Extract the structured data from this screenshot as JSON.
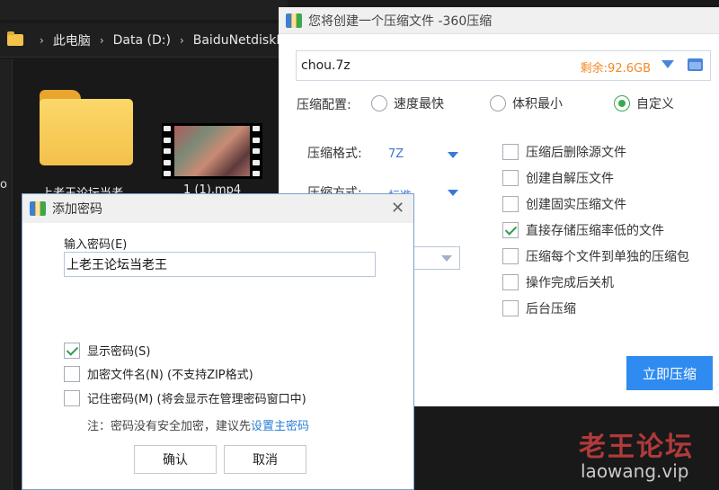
{
  "explorer": {
    "breadcrumb": [
      "此电脑",
      "Data (D:)",
      "BaiduNetdiskD"
    ],
    "folder_label": "上老王论坛当老",
    "video_label": "1 (1).mp4",
    "side_text": "o"
  },
  "compress_window": {
    "title": "您将创建一个压缩文件 -360压缩",
    "filename": "chou.7z",
    "free_space": "剩余:92.6GB",
    "config_label": "压缩配置:",
    "radios": [
      "速度最快",
      "体积最小",
      "自定义"
    ],
    "radio_selected": "自定义",
    "format_label": "压缩格式:",
    "format_value": "7Z",
    "method_label": "压缩方式:",
    "method_value": "标准",
    "options": [
      {
        "label": "压缩后删除源文件",
        "checked": false
      },
      {
        "label": "创建自解压文件",
        "checked": false
      },
      {
        "label": "创建固实压缩文件",
        "checked": false
      },
      {
        "label": "直接存储压缩率低的文件",
        "checked": true
      },
      {
        "label": "压缩每个文件到单独的压缩包",
        "checked": false
      },
      {
        "label": "操作完成后关机",
        "checked": false
      },
      {
        "label": "后台压缩",
        "checked": false
      }
    ],
    "start_button": "立即压缩"
  },
  "password_dialog": {
    "title": "添加密码",
    "input_label": "输入密码(E)",
    "password_value": "上老王论坛当老王",
    "checks": [
      {
        "label": "显示密码(S)",
        "checked": true
      },
      {
        "label": "加密文件名(N) (不支持ZIP格式)",
        "checked": false
      },
      {
        "label": "记住密码(M) (将会显示在管理密码窗口中)",
        "checked": false
      }
    ],
    "note_text": "注：密码没有安全加密，建议先",
    "note_link": "设置主密码",
    "ok_button": "确认",
    "cancel_button": "取消"
  },
  "watermark": {
    "title": "老王论坛",
    "url": "laowang.vip"
  },
  "colors": {
    "accent_blue": "#2f8bf0",
    "free_space_orange": "#f08a24",
    "check_green": "#2e9e4c",
    "watermark_red": "#b13a3a"
  },
  "icons": [
    "folder-icon",
    "video-file-icon",
    "app-logo-icon",
    "close-icon",
    "dropdown-arrow-icon",
    "browse-folder-icon",
    "checkbox-icon",
    "radio-icon"
  ]
}
